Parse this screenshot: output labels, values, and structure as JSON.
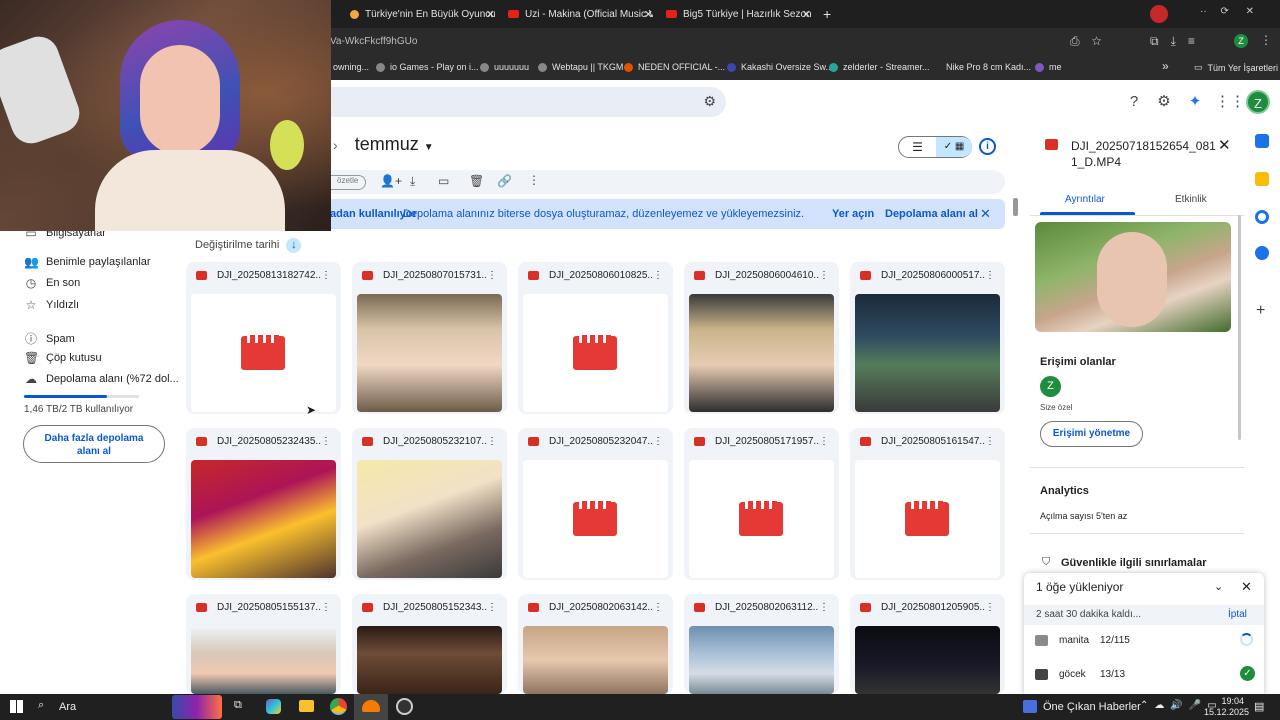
{
  "browser": {
    "tabs": [
      {
        "label": "Türkiye'nin En Büyük Oyuncu D"
      },
      {
        "label": "Uzi - Makina (Official Music Vid"
      },
      {
        "label": "Big5 Türkiye | Hazırlık Sezonu 1"
      }
    ],
    "url": "Va-WkcFkcff9hGUo",
    "bookmarks": [
      "owning...",
      "io Games - Play on i...",
      "uuuuuuu",
      "Webtapu || TKGM",
      "NEDEN OFFICIAL -...",
      "Kakashi Oversize Sw...",
      "zelderler - Streamer...",
      "Nike Pro 8 cm Kadı...",
      "me"
    ],
    "all_bookmarks": "Tüm Yer İşaretleri",
    "more_bookmarks": "»"
  },
  "drive": {
    "breadcrumb_prev": "z,",
    "breadcrumb_sep": "›",
    "breadcrumb_current": "temmuz",
    "toolbar_chip": "özetle",
    "banner_text_bold": "adan kullanılıyor",
    "banner_text": "Depolama alanınız biterse dosya oluşturamaz, düzenleyemez ve yükleyemezsiniz.",
    "banner_action1": "Yer açın",
    "banner_action2": "Depolama alanı al",
    "sort_label": "Değiştirilme tarihi",
    "sidebar": {
      "partial": "Bilgisayarlar",
      "items": [
        {
          "label": "Benimle paylaşılanlar",
          "icon": "people-icon"
        },
        {
          "label": "En son",
          "icon": "clock-icon"
        },
        {
          "label": "Yıldızlı",
          "icon": "star-icon"
        },
        {
          "label": "Spam",
          "icon": "spam-icon"
        },
        {
          "label": "Çöp kutusu",
          "icon": "trash-icon"
        },
        {
          "label": "Depolama alanı (%72 dol...",
          "icon": "cloud-icon"
        }
      ],
      "storage_used": "1,46 TB/2 TB kullanılıyor",
      "storage_fraction": 0.72,
      "get_storage_line1": "Daha fazla depolama",
      "get_storage_line2": "alanı al"
    },
    "files": [
      {
        "name": "DJI_20250813182742...",
        "thumb": "clap"
      },
      {
        "name": "DJI_20250807015731...",
        "thumb": "face"
      },
      {
        "name": "DJI_20250806010825...",
        "thumb": "clap"
      },
      {
        "name": "DJI_20250806004610...",
        "thumb": "face2"
      },
      {
        "name": "DJI_20250806000517...",
        "thumb": "crowd"
      },
      {
        "name": "DJI_20250805232435...",
        "thumb": "table"
      },
      {
        "name": "DJI_20250805232107...",
        "thumb": "face3"
      },
      {
        "name": "DJI_20250805232047...",
        "thumb": "clap"
      },
      {
        "name": "DJI_20250805171957...",
        "thumb": "clap"
      },
      {
        "name": "DJI_20250805161547...",
        "thumb": "clap"
      },
      {
        "name": "DJI_20250805155137...",
        "thumb": "car"
      },
      {
        "name": "DJI_20250805152343...",
        "thumb": "dark"
      },
      {
        "name": "DJI_20250802063142...",
        "thumb": "face4"
      },
      {
        "name": "DJI_20250802063112...",
        "thumb": "sky"
      },
      {
        "name": "DJI_20250801205905...",
        "thumb": "night"
      }
    ],
    "details": {
      "title": "DJI_20250718152654_0811_D.MP4",
      "tab_details": "Ayrıntılar",
      "tab_activity": "Etkinlik",
      "access_heading": "Erişimi olanlar",
      "avatar_letter": "Z",
      "private_label": "Size özel",
      "manage_access": "Erişimi yönetme",
      "analytics_heading": "Analytics",
      "views_text": "Açılma sayısı 5'ten az",
      "security_heading": "Güvenlikle ilgili sınırlamalar"
    },
    "upload": {
      "title": "1 öğe yükleniyor",
      "time_left": "2 saat 30 dakika kaldı...",
      "cancel": "İptal",
      "items": [
        {
          "name": "manita",
          "count": "12/115",
          "status": "uploading"
        },
        {
          "name": "göcek",
          "count": "13/13",
          "status": "done"
        }
      ]
    },
    "user_avatar": "Z"
  },
  "taskbar": {
    "search": "Ara",
    "news": "Öne Çıkan Haberler",
    "time": "19:04",
    "date": "15.12.2025"
  },
  "colors": {
    "accent": "#0b57d0",
    "banner": "#d3e3fd",
    "video_red": "#d93025",
    "avatar_green": "#1e8e3e"
  }
}
